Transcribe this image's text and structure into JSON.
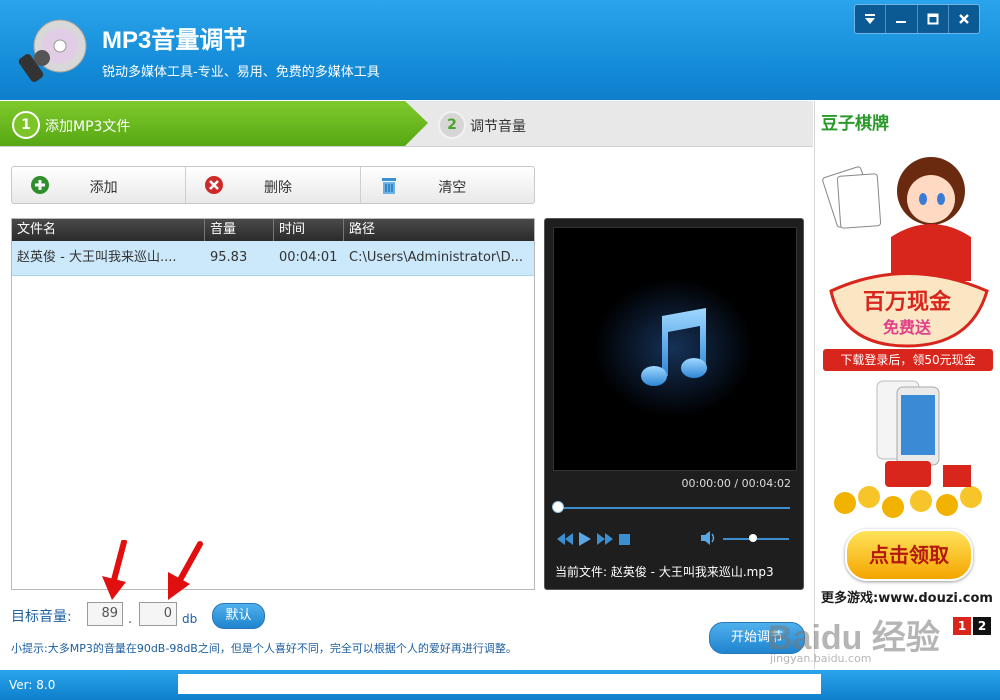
{
  "header": {
    "title": "MP3音量调节",
    "subtitle": "锐动多媒体工具-专业、易用、免费的多媒体工具",
    "window_buttons": [
      "menu-icon",
      "minimize-icon",
      "maximize-icon",
      "close-icon"
    ]
  },
  "steps": [
    {
      "num": "1",
      "label": "添加MP3文件",
      "active": true
    },
    {
      "num": "2",
      "label": "调节音量",
      "active": false
    }
  ],
  "toolbar": {
    "add_label": "添加",
    "delete_label": "删除",
    "clear_label": "清空"
  },
  "file_list": {
    "columns": [
      "文件名",
      "音量",
      "时间",
      "路径"
    ],
    "rows": [
      {
        "name": "赵英俊 - 大王叫我来巡山....",
        "volume": "95.83",
        "time": "00:04:01",
        "path": "C:\\Users\\Administrator\\D..."
      }
    ]
  },
  "player": {
    "time": "00:00:00 / 00:04:02",
    "progress": 0,
    "volume_level": 0.45,
    "now_playing": "当前文件: 赵英俊 - 大王叫我来巡山.mp3"
  },
  "volume": {
    "label": "目标音量:",
    "integer": "89",
    "separator": ".",
    "decimal": "0",
    "unit": "db",
    "default_label": "默认"
  },
  "tip": "小提示:大多MP3的音量在90dB-98dB之间，但是个人喜好不同，完全可以根据个人的爱好再进行调整。",
  "start_label": "开始调节",
  "ad": {
    "brand": "豆子棋牌",
    "banner": "下载登录后，领50元现金",
    "cta": "点击领取",
    "more": "更多游戏:www.douzi.com",
    "pages": [
      "1",
      "2"
    ]
  },
  "status": {
    "version": "Ver: 8.0"
  },
  "watermark": {
    "text": "Baidu 经验",
    "sub": "jingyan.baidu.com"
  },
  "colors": {
    "header": "#138ad6",
    "step_active": "#7cc427",
    "accent": "#1d5fa0",
    "ad_red": "#d9261c"
  }
}
